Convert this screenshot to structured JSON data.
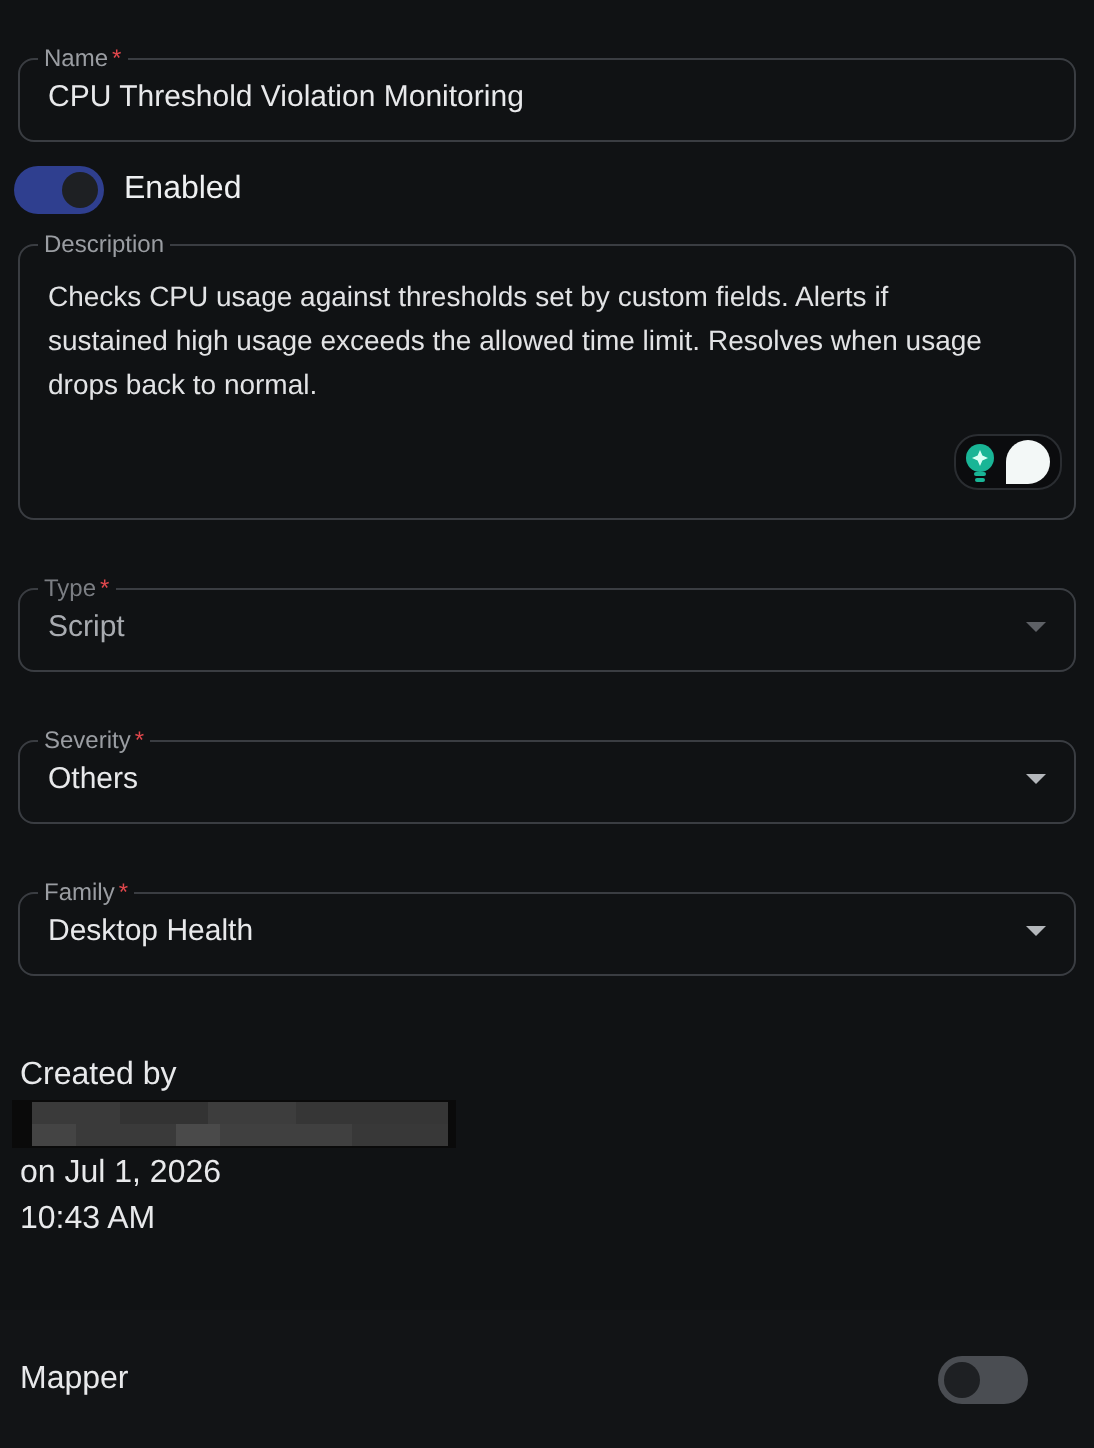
{
  "name_field": {
    "label": "Name",
    "required_mark": "*",
    "value": "CPU Threshold Violation Monitoring"
  },
  "enabled_toggle": {
    "label": "Enabled",
    "on": true
  },
  "description": {
    "label": "Description",
    "value": "Checks CPU usage against thresholds set by custom fields. Alerts if sustained high usage exceeds the allowed time limit. Resolves when usage drops back to normal."
  },
  "selects": [
    {
      "label": "Type",
      "required_mark": "*",
      "value": "Script",
      "disabled": true
    },
    {
      "label": "Severity",
      "required_mark": "*",
      "value": "Others",
      "disabled": false
    },
    {
      "label": "Family",
      "required_mark": "*",
      "value": "Desktop Health",
      "disabled": false
    }
  ],
  "created": {
    "label": "Created by",
    "date": "on Jul 1, 2026",
    "time": "10:43 AM"
  },
  "mapper": {
    "label": "Mapper",
    "on": false
  }
}
